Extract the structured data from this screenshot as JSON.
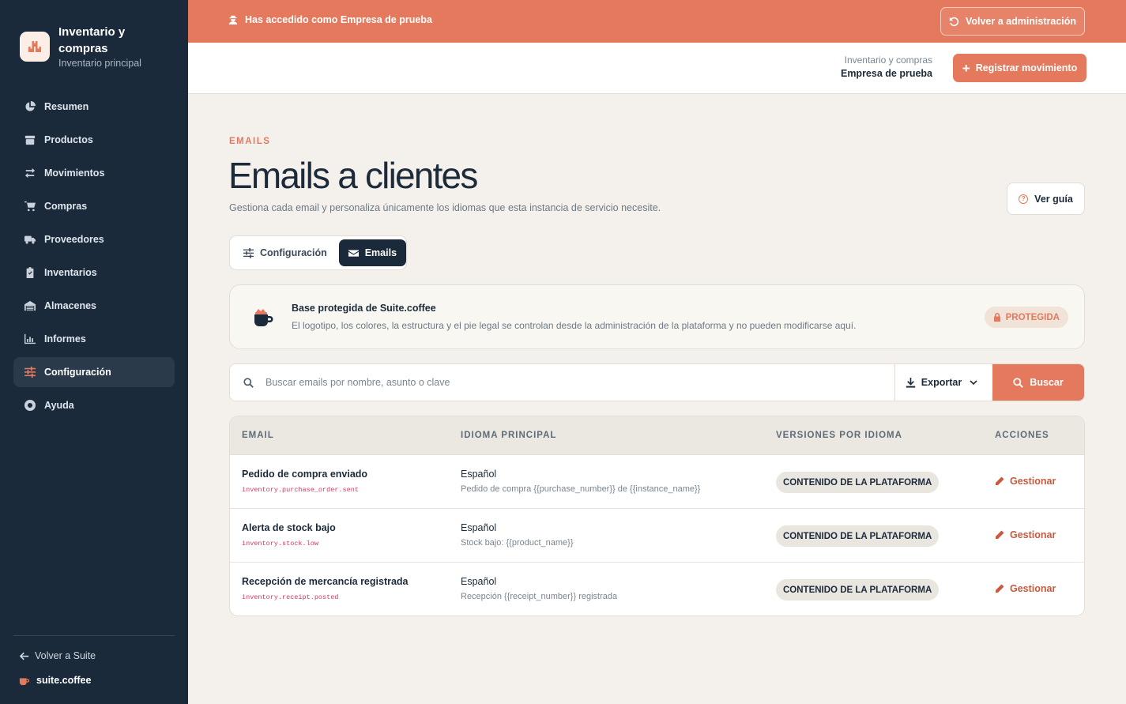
{
  "sidebar": {
    "app_title": "Inventario y compras",
    "app_subtitle": "Inventario principal",
    "items": [
      {
        "label": "Resumen",
        "icon": "pie-chart-icon"
      },
      {
        "label": "Productos",
        "icon": "box-icon"
      },
      {
        "label": "Movimientos",
        "icon": "arrows-icon"
      },
      {
        "label": "Compras",
        "icon": "cart-icon"
      },
      {
        "label": "Proveedores",
        "icon": "truck-icon"
      },
      {
        "label": "Inventarios",
        "icon": "clipboard-check-icon"
      },
      {
        "label": "Almacenes",
        "icon": "warehouse-icon"
      },
      {
        "label": "Informes",
        "icon": "bar-chart-icon"
      },
      {
        "label": "Configuración",
        "icon": "sliders-icon",
        "active": true
      },
      {
        "label": "Ayuda",
        "icon": "lifebuoy-icon"
      }
    ],
    "back_label": "Volver a Suite",
    "suite_label": "suite.coffee"
  },
  "banner": {
    "text": "Has accedido como Empresa de prueba",
    "button_label": "Volver a administración"
  },
  "header": {
    "app_name": "Inventario y compras",
    "company": "Empresa de prueba",
    "primary_button": "Registrar movimiento"
  },
  "page": {
    "eyebrow": "EMAILS",
    "title": "Emails a clientes",
    "description": "Gestiona cada email y personaliza únicamente los idiomas que esta instancia de servicio necesite.",
    "guide_button": "Ver guía"
  },
  "tabs": [
    {
      "label": "Configuración",
      "active": false
    },
    {
      "label": "Emails",
      "active": true
    }
  ],
  "notice": {
    "title": "Base protegida de Suite.coffee",
    "text": "El logotipo, los colores, la estructura y el pie legal se controlan desde la administración de la plataforma y no pueden modificarse aquí.",
    "badge": "PROTEGIDA"
  },
  "search": {
    "placeholder": "Buscar emails por nombre, asunto o clave",
    "value": "",
    "export_label": "Exportar",
    "search_label": "Buscar"
  },
  "table": {
    "headers": [
      "EMAIL",
      "IDIOMA PRINCIPAL",
      "VERSIONES POR IDIOMA",
      "ACCIONES"
    ],
    "rows": [
      {
        "name": "Pedido de compra enviado",
        "key": "inventory.purchase_order.sent",
        "language": "Español",
        "subject": "Pedido de compra {{purchase_number}} de {{instance_name}}",
        "versions": "CONTENIDO DE LA PLATAFORMA",
        "action": "Gestionar"
      },
      {
        "name": "Alerta de stock bajo",
        "key": "inventory.stock.low",
        "language": "Español",
        "subject": "Stock bajo: {{product_name}}",
        "versions": "CONTENIDO DE LA PLATAFORMA",
        "action": "Gestionar"
      },
      {
        "name": "Recepción de mercancía registrada",
        "key": "inventory.receipt.posted",
        "language": "Español",
        "subject": "Recepción {{receipt_number}} registrada",
        "versions": "CONTENIDO DE LA PLATAFORMA",
        "action": "Gestionar"
      }
    ]
  },
  "colors": {
    "accent": "#e5795d",
    "sidebar_bg": "#1b2a3a",
    "page_bg": "#f4f1ec"
  }
}
